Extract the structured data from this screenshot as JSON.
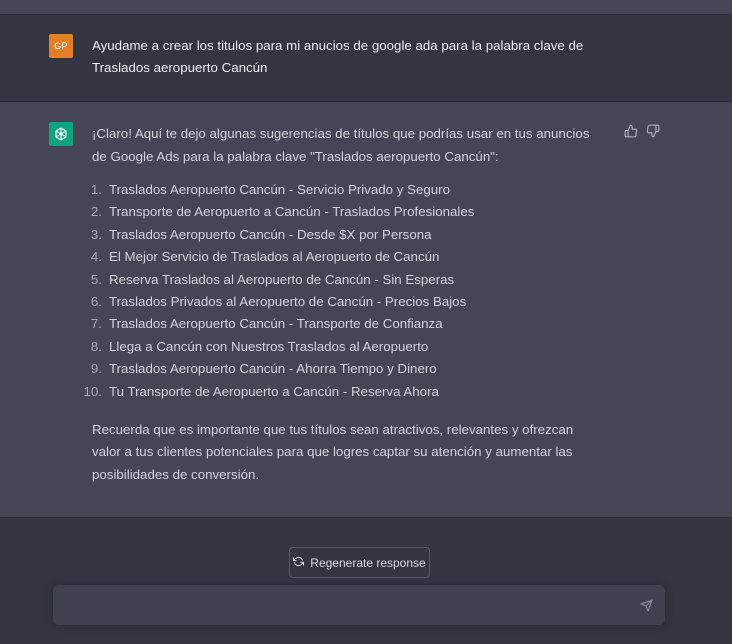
{
  "user_message": {
    "avatar_initials": "GP",
    "text": "Ayudame a crear los titulos para mi anucios de google ada para la palabra clave de Traslados aeropuerto Cancún"
  },
  "assistant_message": {
    "intro": "¡Claro! Aquí te dejo algunas sugerencias de títulos que podrías usar en tus anuncios de Google Ads para la palabra clave \"Traslados aeropuerto Cancún\":",
    "items": [
      {
        "num": "1.",
        "text": "Traslados Aeropuerto Cancún - Servicio Privado y Seguro"
      },
      {
        "num": "2.",
        "text": "Transporte de Aeropuerto a Cancún - Traslados Profesionales"
      },
      {
        "num": "3.",
        "text": "Traslados Aeropuerto Cancún - Desde $X por Persona"
      },
      {
        "num": "4.",
        "text": "El Mejor Servicio de Traslados al Aeropuerto de Cancún"
      },
      {
        "num": "5.",
        "text": "Reserva Traslados al Aeropuerto de Cancún - Sin Esperas"
      },
      {
        "num": "6.",
        "text": "Traslados Privados al Aeropuerto de Cancún - Precios Bajos"
      },
      {
        "num": "7.",
        "text": "Traslados Aeropuerto Cancún - Transporte de Confianza"
      },
      {
        "num": "8.",
        "text": "Llega a Cancún con Nuestros Traslados al Aeropuerto"
      },
      {
        "num": "9.",
        "text": "Traslados Aeropuerto Cancún - Ahorra Tiempo y Dinero"
      },
      {
        "num": "10.",
        "text": "Tu Transporte de Aeropuerto a Cancún - Reserva Ahora"
      }
    ],
    "outro": "Recuerda que es importante que tus títulos sean atractivos, relevantes y ofrezcan valor a tus clientes potenciales para que logres captar su atención y aumentar las posibilidades de conversión."
  },
  "controls": {
    "regenerate_label": "Regenerate response",
    "input_value": "",
    "input_placeholder": ""
  },
  "icons": {
    "assistant_avatar": "openai-logo-icon",
    "thumbs_up": "thumbs-up-icon",
    "thumbs_down": "thumbs-down-icon",
    "regenerate": "refresh-icon",
    "send": "paper-plane-icon"
  },
  "colors": {
    "background": "#343541",
    "assistant_bg": "#444654",
    "user_avatar": "#e57e25",
    "assistant_avatar": "#10a37f",
    "input_bg": "#40414f"
  }
}
